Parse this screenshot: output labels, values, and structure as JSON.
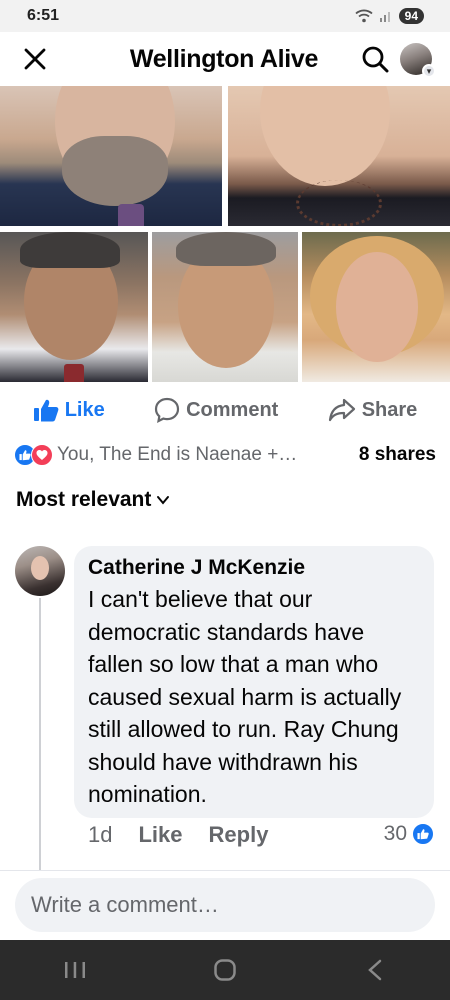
{
  "status_bar": {
    "time": "6:51",
    "battery": "94"
  },
  "header": {
    "title": "Wellington Alive"
  },
  "post_actions": {
    "like": "Like",
    "comment": "Comment",
    "share": "Share"
  },
  "reactions": {
    "summary": "You, The End is Naenae +…",
    "shares": "8 shares"
  },
  "comments_sort": {
    "label": "Most relevant"
  },
  "comment": {
    "author": "Catherine J McKenzie",
    "text": "I can't believe that our democratic standards have fallen so low that a man who caused sexual harm is actually still allowed to run. Ray Chung should have withdrawn his nomination.",
    "time": "1d",
    "like": "Like",
    "reply": "Reply",
    "reaction_count": "30"
  },
  "composer": {
    "placeholder": "Write a comment…"
  },
  "colors": {
    "brand": "#1877f2",
    "love": "#f33e58",
    "secondary_text": "#65676b",
    "bubble": "#f0f2f5"
  },
  "icons": [
    "close-icon",
    "search-icon",
    "like-icon",
    "comment-icon",
    "share-icon",
    "love-icon",
    "chevron-down-icon",
    "recents-icon",
    "home-icon",
    "back-icon"
  ]
}
